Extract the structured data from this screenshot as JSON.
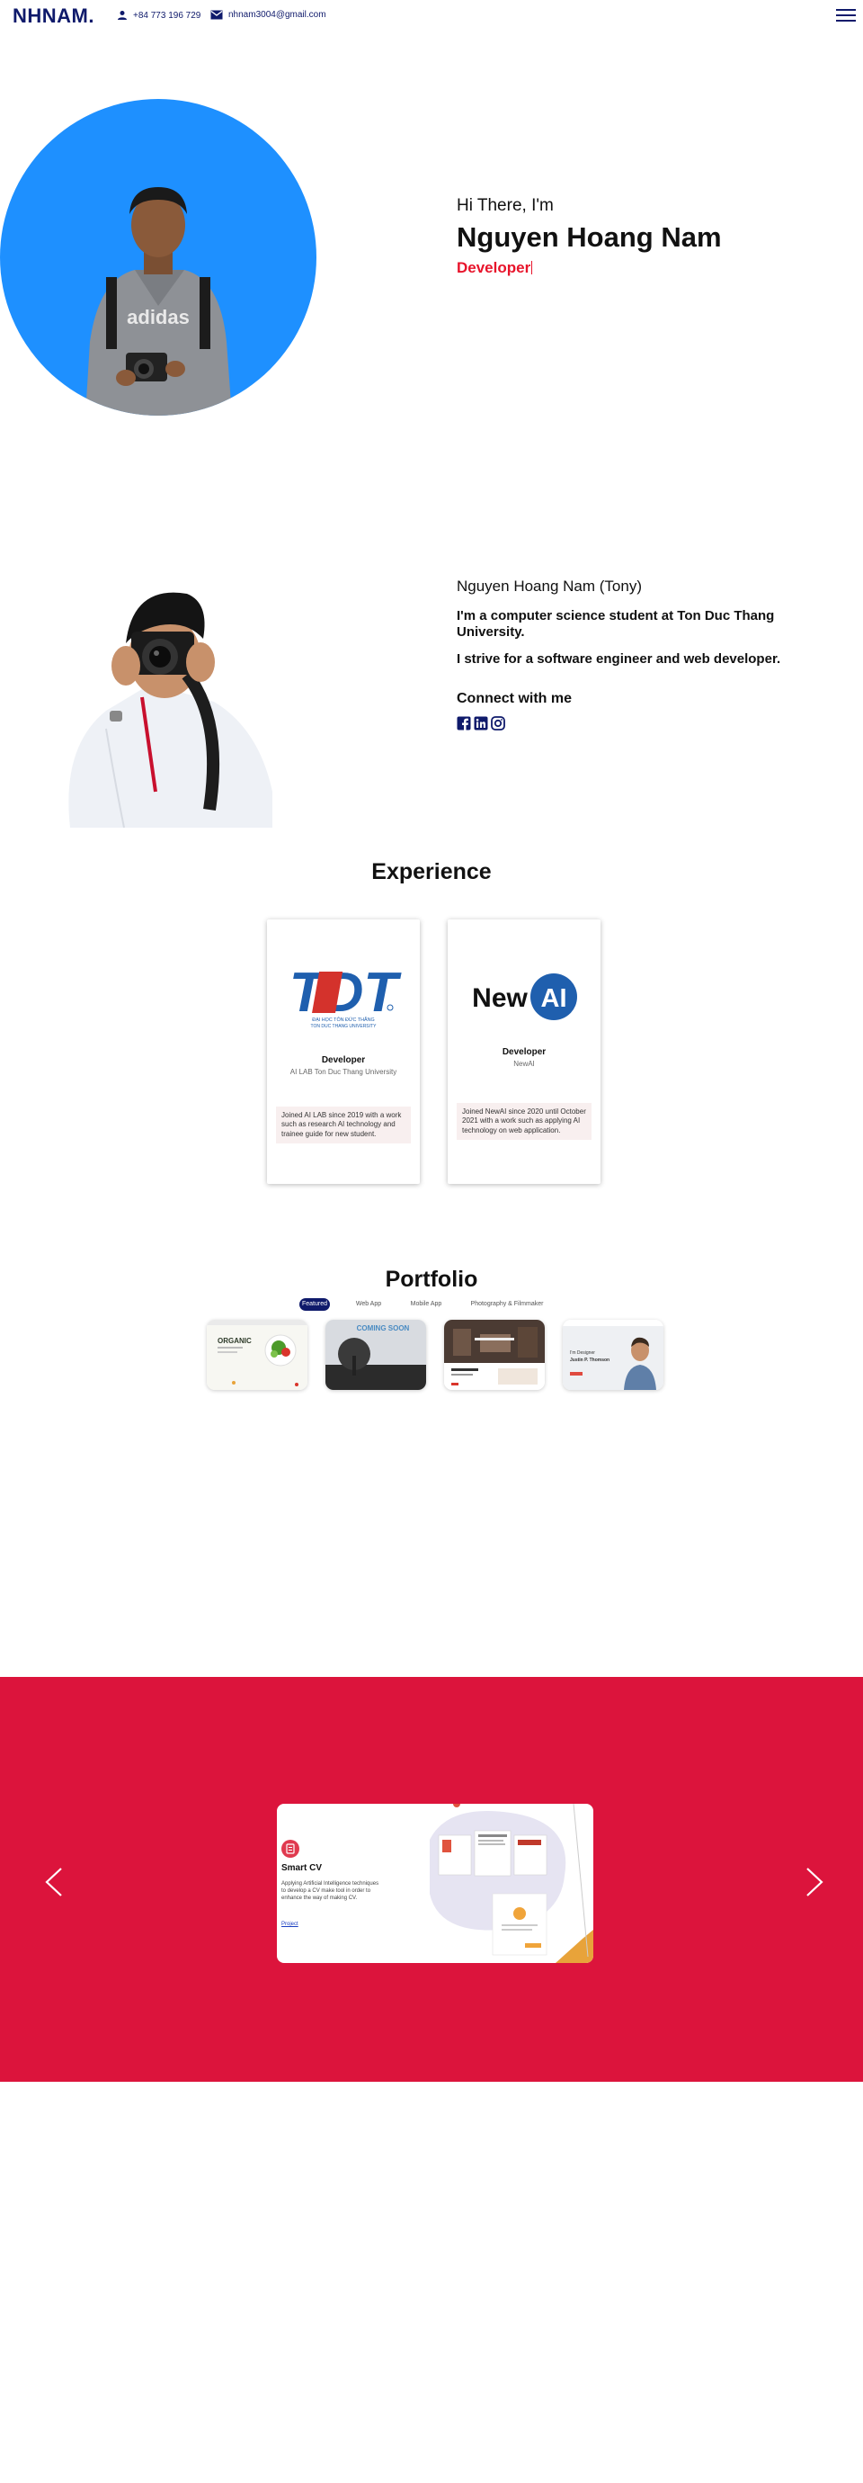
{
  "header": {
    "logo": "NHNAM.",
    "phone": "+84 773 196 729",
    "email": "nhnam3004@gmail.com"
  },
  "hero": {
    "greeting": "Hi There, I'm",
    "name": "Nguyen Hoang Nam",
    "role": "Developer"
  },
  "about": {
    "name": "Nguyen Hoang Nam (Tony)",
    "line1": "I'm a computer science student at Ton Duc Thang University.",
    "line2": "I strive for a software engineer and web developer.",
    "connect": "Connect with me",
    "socials": [
      "facebook-icon",
      "linkedin-icon",
      "instagram-icon"
    ]
  },
  "experience": {
    "title": "Experience",
    "cards": [
      {
        "logo_text": "TDT",
        "logo_sub1": "ĐẠI HỌC TÔN ĐỨC THẮNG",
        "logo_sub2": "TON DUC THANG UNIVERSITY",
        "role": "Developer",
        "org": "AI LAB Ton Duc Thang University",
        "desc": "Joined AI LAB since 2019 with a work such as research AI technology and trainee guide for new student."
      },
      {
        "logo_text_1": "New",
        "logo_text_2": "AI",
        "role": "Developer",
        "org": "NewAI",
        "desc": "Joined NewAI since 2020 until October 2021 with a work such as applying AI technology on web application."
      }
    ]
  },
  "portfolio": {
    "title": "Portfolio",
    "tabs": [
      "Featured",
      "Web App",
      "Mobile App",
      "Photography & Filmmaker"
    ],
    "active_tab": "Featured",
    "thumb_texts": {
      "organic": "ORGANIC",
      "coming_soon": "COMING SOON",
      "designer_1": "I'm Designer",
      "designer_2": "Justin P. Thomson"
    }
  },
  "slider": {
    "title": "Smart CV",
    "desc": "Applying Artificial Intelligence techniques to develop a CV make tool in order to enhance the way of making CV.",
    "link": "Project",
    "background": "#dc143c"
  },
  "colors": {
    "brand": "#0f1a6b",
    "accent": "#e8142b",
    "hero_circle": "#1e90ff"
  }
}
